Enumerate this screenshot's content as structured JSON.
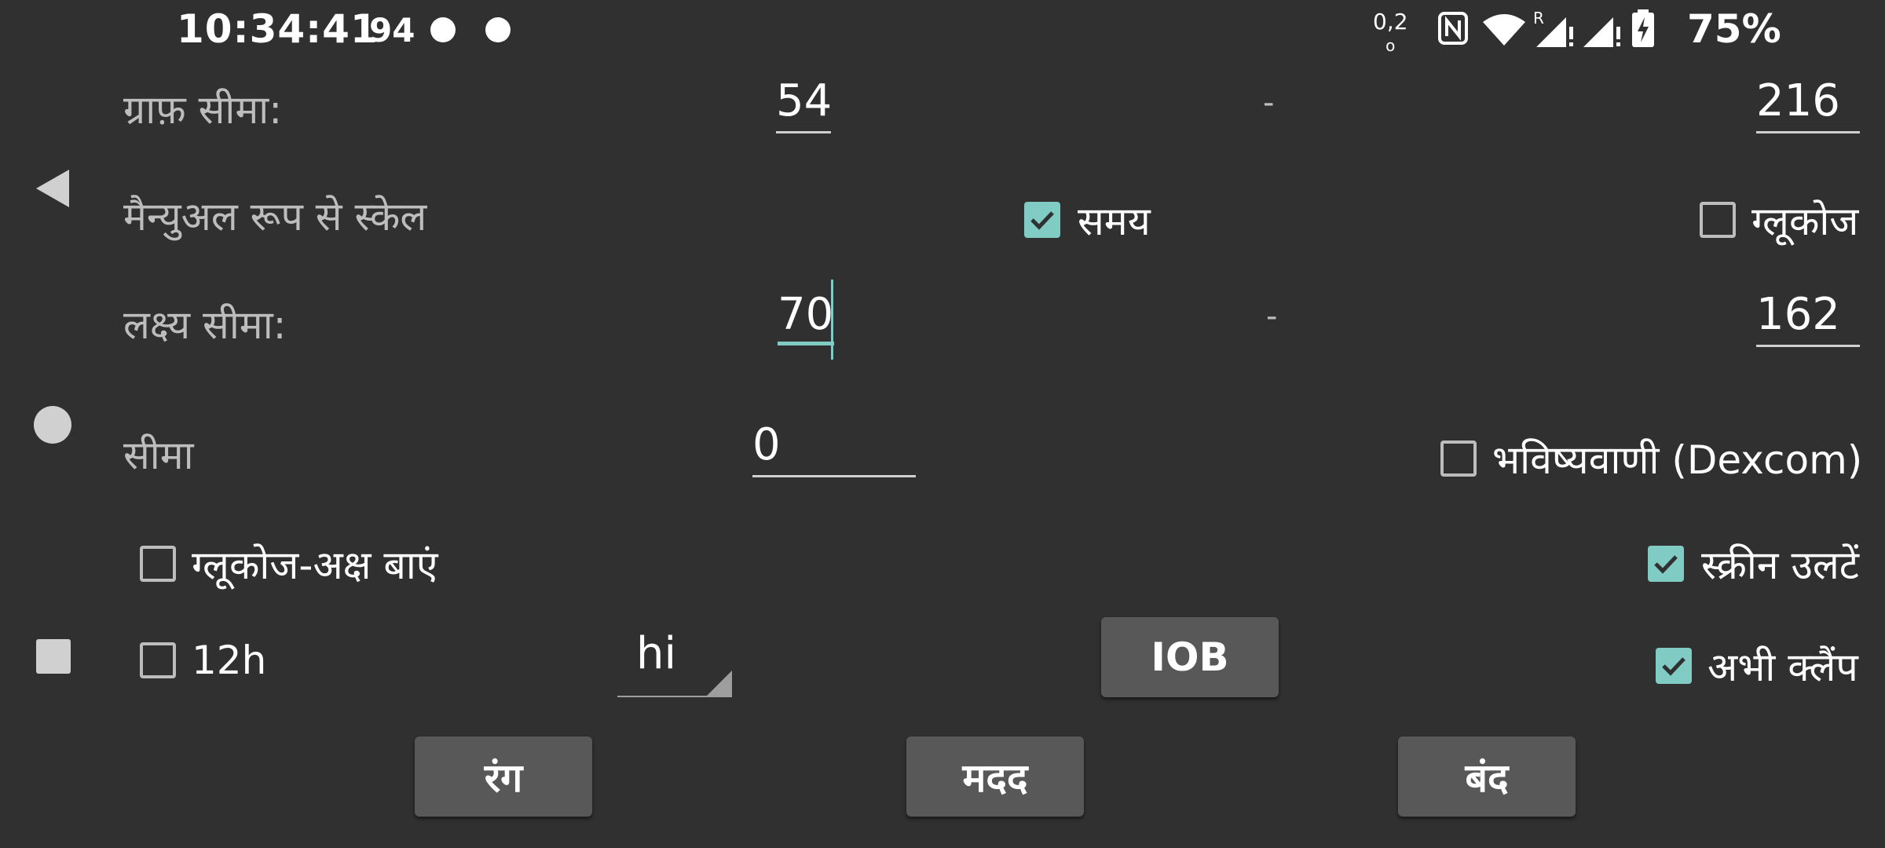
{
  "status_bar": {
    "time": "10:34:41",
    "notification_count": "94",
    "net_speed_value": "0,2",
    "battery_percent": "75%"
  },
  "graph_range": {
    "label": "ग्राफ़ सीमा:",
    "min": "54",
    "separator": "-",
    "max": "216"
  },
  "manual_scale": {
    "label": "मैन्युअल रूप से स्केल",
    "time_label": "समय",
    "time_checked": true,
    "glucose_label": "ग्लूकोज",
    "glucose_checked": false
  },
  "target_range": {
    "label": "लक्ष्य सीमा:",
    "min": "70",
    "separator": "-",
    "max": "162"
  },
  "limit": {
    "label": "सीमा",
    "value": "0",
    "prediction_label": "भविष्यवाणी (Dexcom)",
    "prediction_checked": false
  },
  "glucose_axis_left": {
    "label": "ग्लूकोज-अक्ष बाएं",
    "checked": false
  },
  "flip_screen": {
    "label": "स्क्रीन उलटें",
    "checked": true
  },
  "twelve_hour": {
    "label": "12h",
    "checked": false
  },
  "language_select": {
    "value": "hi"
  },
  "iob_button": {
    "label": "IOB"
  },
  "now_clamp": {
    "label": "अभी क्लैंप",
    "checked": true
  },
  "buttons": {
    "color": "रंग",
    "help": "मदद",
    "close": "बंद"
  },
  "colors": {
    "background": "#303030",
    "accent": "#80cbc4",
    "button": "#585858"
  }
}
